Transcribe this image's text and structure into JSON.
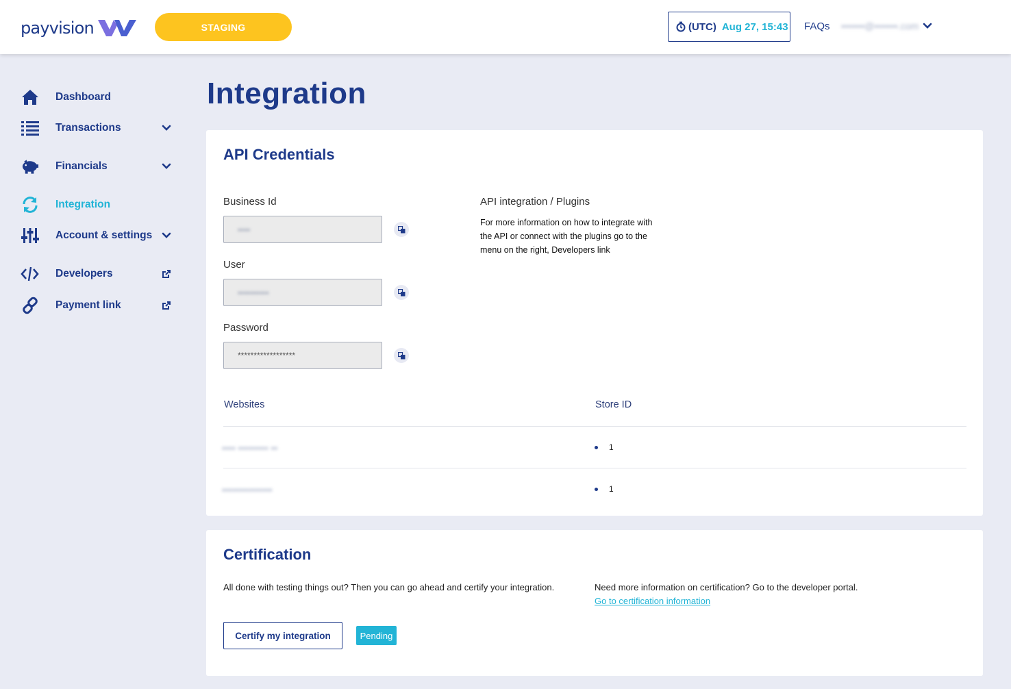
{
  "header": {
    "logo_text": "payvision",
    "env_badge": "STAGING",
    "timezone": "(UTC)",
    "time": "Aug 27, 15:43",
    "faqs": "FAQs",
    "user_email": "•••••••@•••••••.com"
  },
  "sidebar": {
    "items": [
      {
        "label": "Dashboard",
        "icon": "home-icon"
      },
      {
        "label": "Transactions",
        "icon": "list-icon"
      },
      {
        "label": "Financials",
        "icon": "piggy-bank-icon"
      },
      {
        "label": "Integration",
        "icon": "sync-icon",
        "active": true
      },
      {
        "label": "Account & settings",
        "icon": "sliders-icon"
      },
      {
        "label": "Developers",
        "icon": "code-icon"
      },
      {
        "label": "Payment link",
        "icon": "link-icon"
      }
    ]
  },
  "page": {
    "title": "Integration"
  },
  "api_credentials": {
    "title": "API Credentials",
    "business_id_label": "Business Id",
    "business_id_value": "••••",
    "user_label": "User",
    "user_value": "••••••••••",
    "password_label": "Password",
    "password_value": "******************",
    "plugins_title": "API integration / Plugins",
    "plugins_text": "For more information on how to integrate with the API or connect with the plugins go to the menu on the right, Developers link",
    "table": {
      "headers": [
        "Websites",
        "Store ID"
      ],
      "rows": [
        {
          "website": "•••• ••••••••• ••",
          "store_id": "1"
        },
        {
          "website": "•••••••••••••••",
          "store_id": "1"
        }
      ]
    }
  },
  "certification": {
    "title": "Certification",
    "left_text": "All done with testing things out? Then you can go ahead and certify your integration.",
    "right_text": "Need more information on certification? Go to the developer portal.",
    "link_text": "Go to certification information",
    "button_label": "Certify my integration",
    "status_badge": "Pending"
  },
  "colors": {
    "brand_navy": "#1e3a8a",
    "accent_cyan": "#22b4d6",
    "staging_yellow": "#fdc41f",
    "background": "#e9ebf4"
  }
}
